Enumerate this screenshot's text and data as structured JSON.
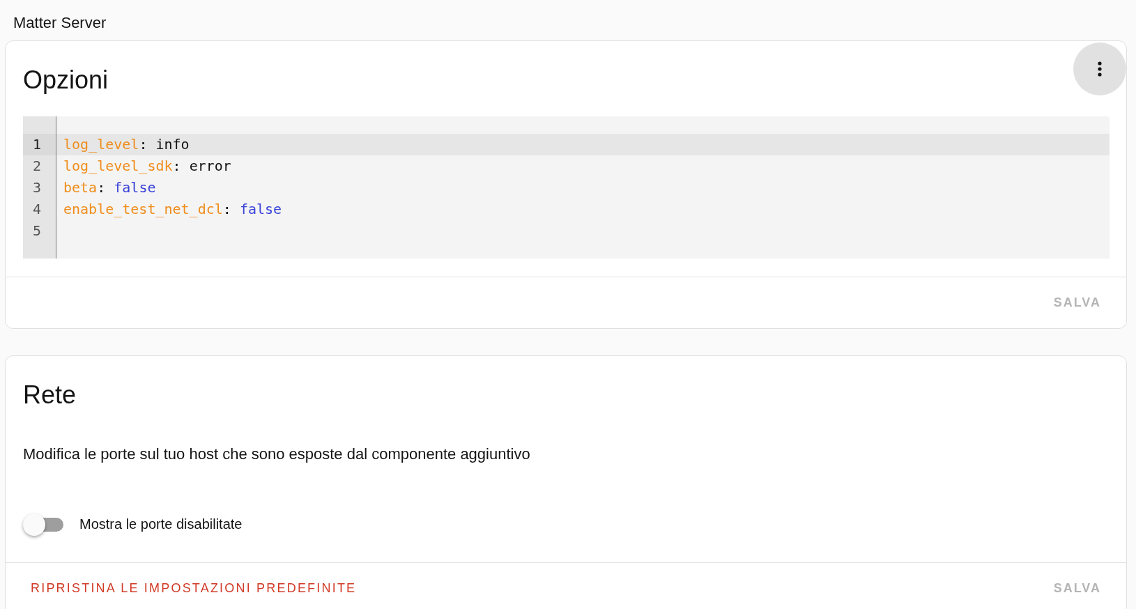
{
  "page_title": "Matter Server",
  "options_card": {
    "title": "Opzioni",
    "editor_lines": [
      {
        "number": "1",
        "active": true,
        "tokens": [
          {
            "kind": "key",
            "text": "log_level"
          },
          {
            "kind": "punct",
            "text": ": "
          },
          {
            "kind": "string",
            "text": "info"
          }
        ]
      },
      {
        "number": "2",
        "active": false,
        "tokens": [
          {
            "kind": "key",
            "text": "log_level_sdk"
          },
          {
            "kind": "punct",
            "text": ": "
          },
          {
            "kind": "string",
            "text": "error"
          }
        ]
      },
      {
        "number": "3",
        "active": false,
        "tokens": [
          {
            "kind": "key",
            "text": "beta"
          },
          {
            "kind": "punct",
            "text": ": "
          },
          {
            "kind": "boolean",
            "text": "false"
          }
        ]
      },
      {
        "number": "4",
        "active": false,
        "tokens": [
          {
            "kind": "key",
            "text": "enable_test_net_dcl"
          },
          {
            "kind": "punct",
            "text": ": "
          },
          {
            "kind": "boolean",
            "text": "false"
          }
        ]
      },
      {
        "number": "5",
        "active": false
      }
    ],
    "save_button": {
      "label": "SALVA",
      "disabled": true
    }
  },
  "network_card": {
    "title": "Rete",
    "description": "Modifica le porte sul tuo host che sono esposte dal componente aggiuntivo",
    "toggle": {
      "label": "Mostra le porte disabilitate",
      "on": false
    },
    "reset_button": {
      "label": "RIPRISTINA LE IMPOSTAZIONI PREDEFINITE"
    },
    "save_button": {
      "label": "SALVA",
      "disabled": true
    }
  }
}
